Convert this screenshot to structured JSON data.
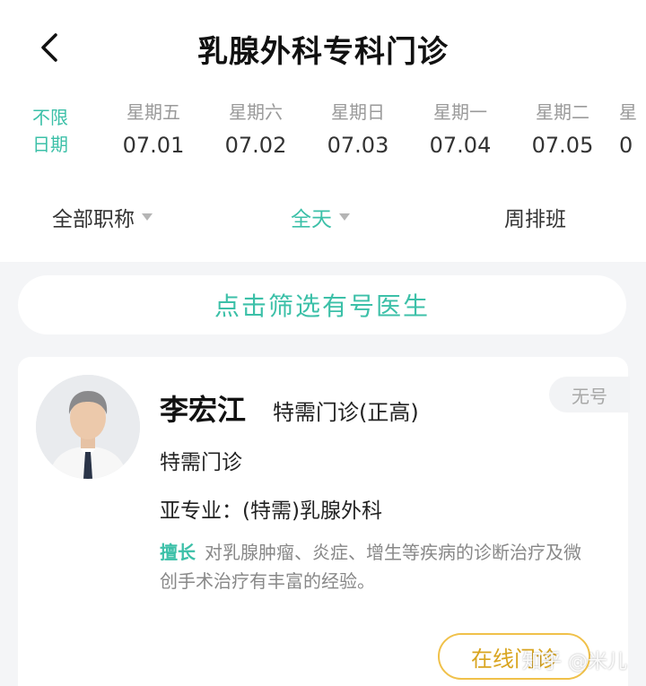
{
  "header": {
    "title": "乳腺外科专科门诊",
    "back_icon": "chevron-left-icon"
  },
  "dates": {
    "no_limit_line1": "不限",
    "no_limit_line2": "日期",
    "days": [
      {
        "weekday": "星期五",
        "date": "07.01"
      },
      {
        "weekday": "星期六",
        "date": "07.02"
      },
      {
        "weekday": "星期日",
        "date": "07.03"
      },
      {
        "weekday": "星期一",
        "date": "07.04"
      },
      {
        "weekday": "星期二",
        "date": "07.05"
      },
      {
        "weekday": "星",
        "date": "0"
      }
    ]
  },
  "filters": {
    "title_filter": "全部职称",
    "time_filter": "全天",
    "weekly_schedule": "周排班"
  },
  "filter_doctor_button": "点击筛选有号医生",
  "doctor": {
    "name": "李宏江",
    "clinic_title": "特需门诊(正高)",
    "clinic_type": "特需门诊",
    "subspecialty": "亚专业：(特需)乳腺外科",
    "expertise_label": "擅长",
    "expertise_text": "对乳腺肿瘤、炎症、增生等疾病的诊断治疗及微创手术治疗有丰富的经验。",
    "slot_status": "无号",
    "consult_button": "在线门诊"
  },
  "watermark": "知乎 @米儿",
  "colors": {
    "accent": "#3cc0a8",
    "consult_border": "#f0c14a",
    "background": "#f4f5f7"
  }
}
